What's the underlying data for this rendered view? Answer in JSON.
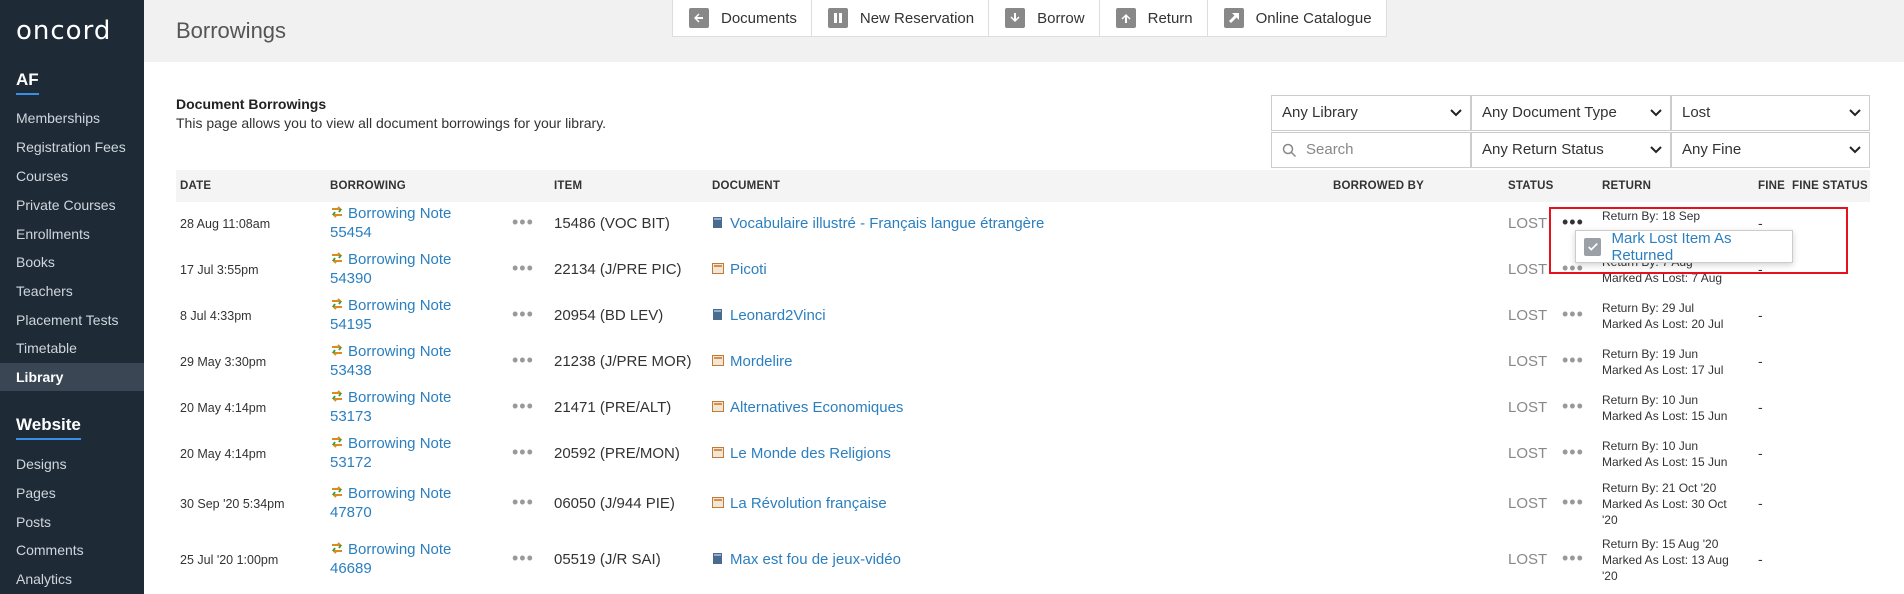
{
  "app": {
    "logo": "oncord"
  },
  "sidebar": {
    "section1_title": "AF",
    "section1_items": [
      {
        "label": "Memberships"
      },
      {
        "label": "Registration Fees"
      },
      {
        "label": "Courses"
      },
      {
        "label": "Private Courses"
      },
      {
        "label": "Enrollments"
      },
      {
        "label": "Books"
      },
      {
        "label": "Teachers"
      },
      {
        "label": "Placement Tests"
      },
      {
        "label": "Timetable"
      },
      {
        "label": "Library",
        "active": true
      }
    ],
    "section2_title": "Website",
    "section2_items": [
      {
        "label": "Designs"
      },
      {
        "label": "Pages"
      },
      {
        "label": "Posts"
      },
      {
        "label": "Comments"
      },
      {
        "label": "Analytics"
      }
    ]
  },
  "header": {
    "title": "Borrowings"
  },
  "toolbar": {
    "buttons": [
      {
        "label": "Documents",
        "icon": "arrow-left-icon"
      },
      {
        "label": "New Reservation",
        "icon": "pause-icon"
      },
      {
        "label": "Borrow",
        "icon": "arrow-down-icon"
      },
      {
        "label": "Return",
        "icon": "arrow-up-icon"
      },
      {
        "label": "Online Catalogue",
        "icon": "external-link-icon"
      }
    ]
  },
  "section": {
    "heading": "Document Borrowings",
    "description": "This page allows you to view all document borrowings for your library."
  },
  "filters": {
    "library": "Any Library",
    "document_type": "Any Document Type",
    "status": "Lost",
    "search_placeholder": "Search",
    "return_status": "Any Return Status",
    "fine": "Any Fine"
  },
  "table": {
    "headers": {
      "date": "DATE",
      "borrowing": "BORROWING",
      "item": "ITEM",
      "document": "DOCUMENT",
      "borrowed_by": "BORROWED BY",
      "status": "STATUS",
      "return": "RETURN",
      "fine": "FINE",
      "fine_status": "FINE STATUS"
    },
    "rows": [
      {
        "date": "28 Aug 11:08am",
        "note1": "Borrowing Note",
        "note2": "55454",
        "item": "15486 (VOC BIT)",
        "document": "Vocabulaire illustré - Français langue étrangère",
        "doc_type": "book",
        "status": "LOST",
        "ret1": "Return By: 18 Sep",
        "ret2": "",
        "ret3": "",
        "fine": "-"
      },
      {
        "date": "17 Jul 3:55pm",
        "note1": "Borrowing Note",
        "note2": "54390",
        "item": "22134 (J/PRE PIC)",
        "document": "Picoti",
        "doc_type": "magazine",
        "status": "LOST",
        "ret1": "Return By: 7 Aug",
        "ret2": "Marked As Lost: 7 Aug",
        "ret3": "",
        "fine": "-"
      },
      {
        "date": "8 Jul 4:33pm",
        "note1": "Borrowing Note",
        "note2": "54195",
        "item": "20954 (BD LEV)",
        "document": "Leonard2Vinci",
        "doc_type": "book",
        "status": "LOST",
        "ret1": "Return By: 29 Jul",
        "ret2": "Marked As Lost: 20 Jul",
        "ret3": "",
        "fine": "-"
      },
      {
        "date": "29 May 3:30pm",
        "note1": "Borrowing Note",
        "note2": "53438",
        "item": "21238 (J/PRE MOR)",
        "document": "Mordelire",
        "doc_type": "magazine",
        "status": "LOST",
        "ret1": "Return By: 19 Jun",
        "ret2": "Marked As Lost: 17 Jul",
        "ret3": "",
        "fine": "-"
      },
      {
        "date": "20 May 4:14pm",
        "note1": "Borrowing Note",
        "note2": "53173",
        "item": "21471 (PRE/ALT)",
        "document": "Alternatives Economiques",
        "doc_type": "magazine",
        "status": "LOST",
        "ret1": "Return By: 10 Jun",
        "ret2": "Marked As Lost: 15 Jun",
        "ret3": "",
        "fine": "-"
      },
      {
        "date": "20 May 4:14pm",
        "note1": "Borrowing Note",
        "note2": "53172",
        "item": "20592 (PRE/MON)",
        "document": "Le Monde des Religions",
        "doc_type": "magazine",
        "status": "LOST",
        "ret1": "Return By: 10 Jun",
        "ret2": "Marked As Lost: 15 Jun",
        "ret3": "",
        "fine": "-"
      },
      {
        "date": "30 Sep '20 5:34pm",
        "note1": "Borrowing Note",
        "note2": "47870",
        "item": "06050 (J/944 PIE)",
        "document": "La Révolution française",
        "doc_type": "magazine",
        "status": "LOST",
        "ret1": "Return By: 21 Oct '20",
        "ret2": "Marked As Lost: 30 Oct",
        "ret3": "'20",
        "fine": "-"
      },
      {
        "date": "25 Jul '20 1:00pm",
        "note1": "Borrowing Note",
        "note2": "46689",
        "item": "05519 (J/R SAI)",
        "document": "Max est fou de jeux-vidéo",
        "doc_type": "book",
        "status": "LOST",
        "ret1": "Return By: 15 Aug '20",
        "ret2": "Marked As Lost: 13 Aug",
        "ret3": "'20",
        "fine": "-"
      }
    ]
  },
  "popup": {
    "label": "Mark Lost Item As Returned"
  },
  "colors": {
    "sidebar_bg": "#1e2a36",
    "link": "#2b7fbf",
    "highlight": "#e8101a"
  }
}
